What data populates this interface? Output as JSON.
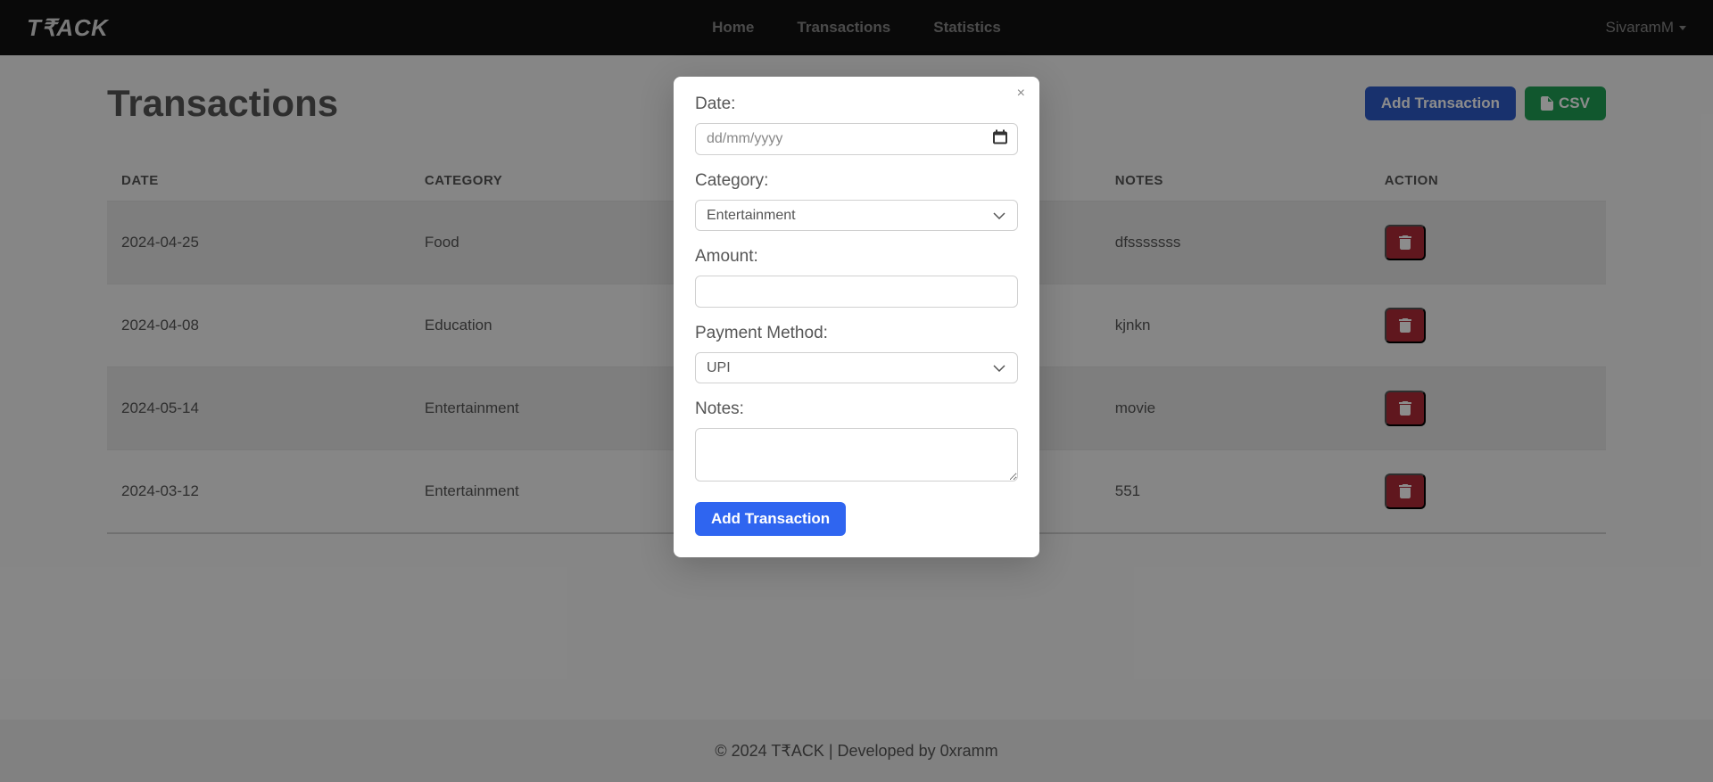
{
  "brand": "T₹ACK",
  "nav": {
    "home": "Home",
    "transactions": "Transactions",
    "statistics": "Statistics",
    "user": "SivaramM"
  },
  "page": {
    "title": "Transactions",
    "add_button": "Add Transaction",
    "csv_button": "CSV"
  },
  "table": {
    "headers": {
      "date": "DATE",
      "category": "CATEGORY",
      "notes": "NOTES",
      "action": "ACTION"
    },
    "rows": [
      {
        "date": "2024-04-25",
        "category": "Food",
        "notes": "dfsssssss"
      },
      {
        "date": "2024-04-08",
        "category": "Education",
        "notes": "kjnkn"
      },
      {
        "date": "2024-05-14",
        "category": "Entertainment",
        "notes": "movie"
      },
      {
        "date": "2024-03-12",
        "category": "Entertainment",
        "notes": "551"
      }
    ]
  },
  "modal": {
    "labels": {
      "date": "Date:",
      "category": "Category:",
      "amount": "Amount:",
      "payment_method": "Payment Method:",
      "notes": "Notes:"
    },
    "placeholders": {
      "date": "dd/mm/yyyy"
    },
    "values": {
      "category": "Entertainment",
      "payment_method": "UPI"
    },
    "submit": "Add Transaction",
    "close": "×"
  },
  "footer": "© 2024 T₹ACK | Developed by 0xramm"
}
